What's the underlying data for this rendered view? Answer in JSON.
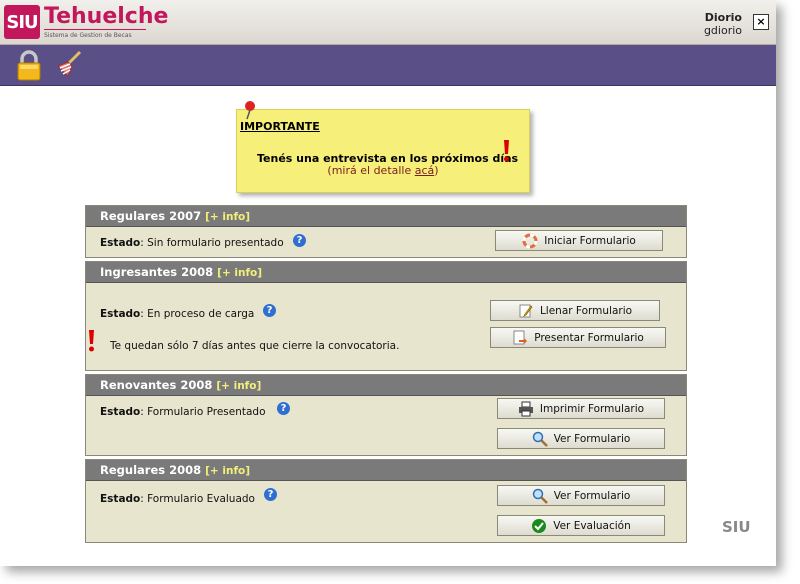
{
  "app": {
    "logo_badge": "SIU",
    "name": "Tehuelche",
    "subtitle": "Sistema de Gestion de Becas"
  },
  "user": {
    "name": "Diorio",
    "login": "gdiorio",
    "close_label": "×"
  },
  "toolbar": {
    "lock_icon": "lock-icon",
    "clean_icon": "broom-icon"
  },
  "notice": {
    "title": "IMPORTANTE",
    "message": "Tenés una entrevista en los próximos días",
    "detail_prefix": "(mirá el detalle ",
    "detail_link": "acá",
    "detail_suffix": ")"
  },
  "panels": [
    {
      "title": "Regulares 2007",
      "info": "[+ info]",
      "estado_label": "Estado",
      "estado_value": ": Sin formulario presentado",
      "buttons": [
        {
          "label": "Iniciar Formulario",
          "icon": "lifebuoy-icon"
        }
      ]
    },
    {
      "title": "Ingresantes 2008",
      "info": "[+ info]",
      "estado_label": "Estado",
      "estado_value": ": En proceso de carga",
      "warning": "Te quedan sólo 7 días antes que cierre la convocatoria.",
      "buttons": [
        {
          "label": "Llenar Formulario",
          "icon": "pencil-icon"
        },
        {
          "label": "Presentar Formulario",
          "icon": "document-arrow-icon"
        }
      ]
    },
    {
      "title": "Renovantes 2008",
      "info": "[+ info]",
      "estado_label": "Estado",
      "estado_value": ": Formulario Presentado",
      "buttons": [
        {
          "label": "Imprimir Formulario",
          "icon": "printer-icon"
        },
        {
          "label": "Ver Formulario",
          "icon": "magnifier-icon"
        }
      ]
    },
    {
      "title": "Regulares 2008",
      "info": "[+ info]",
      "estado_label": "Estado",
      "estado_value": ": Formulario Evaluado",
      "buttons": [
        {
          "label": "Ver Formulario",
          "icon": "magnifier-icon"
        },
        {
          "label": "Ver Evaluación",
          "icon": "checkmark-icon"
        }
      ]
    }
  ],
  "footer_logo": "SIU",
  "help_glyph": "?",
  "colors": {
    "brand": "#c2185b",
    "toolbar": "#5a4f86",
    "panel_header": "#7a7a7a",
    "panel_body": "#e8e5cf",
    "note": "#f6f07a",
    "info_link": "#f2f07a"
  }
}
